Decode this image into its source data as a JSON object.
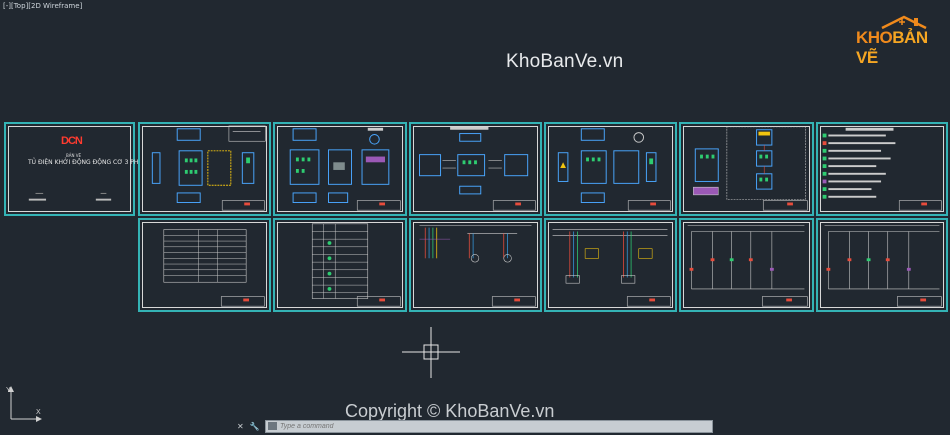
{
  "viewport": {
    "view_label": "[-][Top][2D Wireframe]",
    "background": "#212830"
  },
  "watermark": "KhoBanVe.vn",
  "copyright": "Copyright © KhoBanVe.vn",
  "logo": {
    "part1": "KHO",
    "part2": "BẢN VẼ"
  },
  "cover_sheet": {
    "logo": "DCN",
    "subtitle": "BẢN VẼ",
    "title": "TỦ ĐIỆN KHỞI ĐỘNG ĐỘNG CƠ 3 PHA"
  },
  "command_line": {
    "placeholder": "Type a command"
  },
  "command_icons": [
    "close-icon",
    "wrench-icon"
  ],
  "colors": {
    "sheet_border": "#34b3b5",
    "model_bg": "#212830"
  }
}
